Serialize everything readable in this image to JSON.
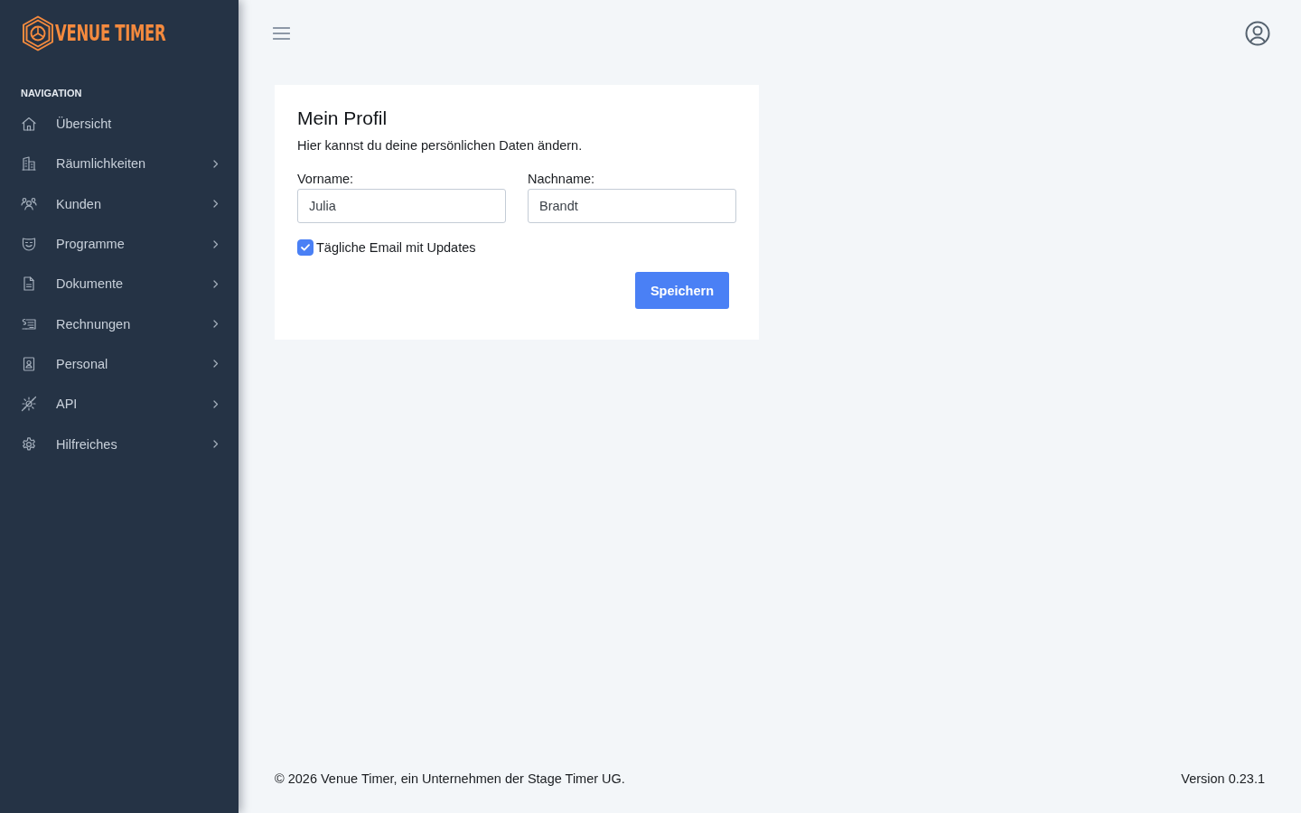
{
  "sidebar": {
    "logo": {
      "text": "VENUE TIMER"
    },
    "section_title": "NAVIGATION",
    "items": [
      {
        "label": "Übersicht",
        "expandable": false
      },
      {
        "label": "Räumlichkeiten",
        "expandable": true
      },
      {
        "label": "Kunden",
        "expandable": true
      },
      {
        "label": "Programme",
        "expandable": true
      },
      {
        "label": "Dokumente",
        "expandable": true
      },
      {
        "label": "Rechnungen",
        "expandable": true
      },
      {
        "label": "Personal",
        "expandable": true
      },
      {
        "label": "API",
        "expandable": true
      },
      {
        "label": "Hilfreiches",
        "expandable": true
      }
    ]
  },
  "profile_card": {
    "title": "Mein Profil",
    "subtitle": "Hier kannst du deine persönlichen Daten ändern.",
    "fields": [
      {
        "label": "Vorname:",
        "value": "Julia"
      },
      {
        "label": "Nachname:",
        "value": "Brandt"
      }
    ],
    "newsletter": {
      "label": "Tägliche Email mit Updates",
      "checked": true
    },
    "save_button": "Speichern"
  },
  "footer": {
    "copyright": "© 2026 Venue Timer, ein Unternehmen der Stage Timer UG.",
    "version": "Version 0.23.1"
  }
}
